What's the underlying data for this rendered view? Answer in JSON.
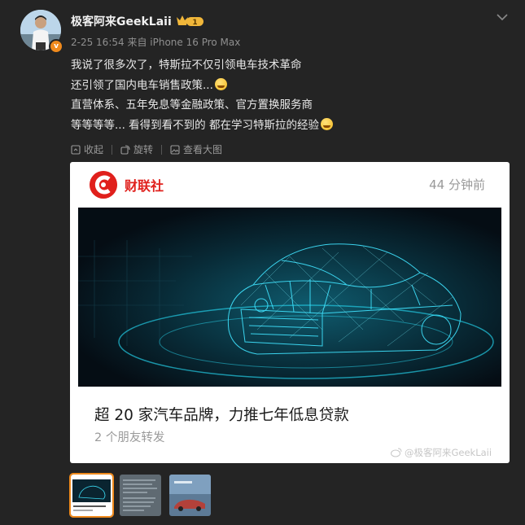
{
  "user": {
    "name": "极客阿来GeekLaii",
    "vip_level": "1",
    "verified_mark": "v",
    "avatar_icon": "user-avatar"
  },
  "meta": {
    "time": "2-25 16:54",
    "source": "来自 iPhone 16 Pro Max"
  },
  "post": {
    "lines": [
      "我说了很多次了，特斯拉不仅引领电车技术革命",
      "还引领了国内电车销售政策...",
      "直营体系、五年免息等金融政策、官方置换服务商",
      "等等等等... 看得到看不到的 都在学习特斯拉的经验"
    ],
    "emoji_name": "laugh-cry-emoji"
  },
  "actions": {
    "collapse": "收起",
    "rotate": "旋转",
    "view_large": "查看大图"
  },
  "card": {
    "brand": "财联社",
    "time": "44 分钟前",
    "title": "超 20 家汽车品牌，力推七年低息贷款",
    "subtitle": "2 个朋友转发",
    "brand_color": "#e0201c"
  },
  "watermark": "@极客阿来GeekLaii",
  "thumbnails": [
    "thumbnail-1",
    "thumbnail-2",
    "thumbnail-3"
  ],
  "colors": {
    "background": "#242424",
    "accent": "#f08a1c"
  }
}
